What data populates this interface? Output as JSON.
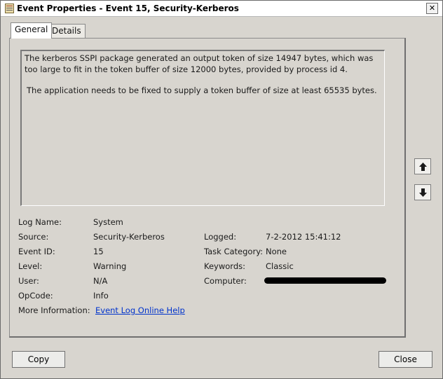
{
  "window": {
    "title": "Event Properties - Event 15, Security-Kerberos",
    "close_glyph": "✕"
  },
  "tabs": [
    {
      "label": "General",
      "active": true
    },
    {
      "label": "Details",
      "active": false
    }
  ],
  "description": {
    "line1": "The kerberos SSPI package generated an output token of size 14947 bytes, which was too large to fit in the token buffer of size 12000 bytes, provided by process id 4.",
    "line2": "The application needs to be fixed to supply a token buffer of size at least 65535 bytes."
  },
  "fields": {
    "log_name": {
      "label": "Log Name:",
      "value": "System"
    },
    "source": {
      "label": "Source:",
      "value": "Security-Kerberos"
    },
    "event_id": {
      "label": "Event ID:",
      "value": "15"
    },
    "level": {
      "label": "Level:",
      "value": "Warning"
    },
    "user": {
      "label": "User:",
      "value": "N/A"
    },
    "opcode": {
      "label": "OpCode:",
      "value": "Info"
    },
    "more_info": {
      "label": "More Information:",
      "value": "Event Log Online Help"
    },
    "logged": {
      "label": "Logged:",
      "value": "7-2-2012 15:41:12"
    },
    "task_category": {
      "label": "Task Category:",
      "value": "None"
    },
    "keywords": {
      "label": "Keywords:",
      "value": "Classic"
    },
    "computer": {
      "label": "Computer:",
      "value": ""
    }
  },
  "buttons": {
    "copy": "Copy",
    "close": "Close"
  },
  "icons": {
    "app": "event-viewer-icon",
    "up": "arrow-up-icon",
    "down": "arrow-down-icon"
  }
}
